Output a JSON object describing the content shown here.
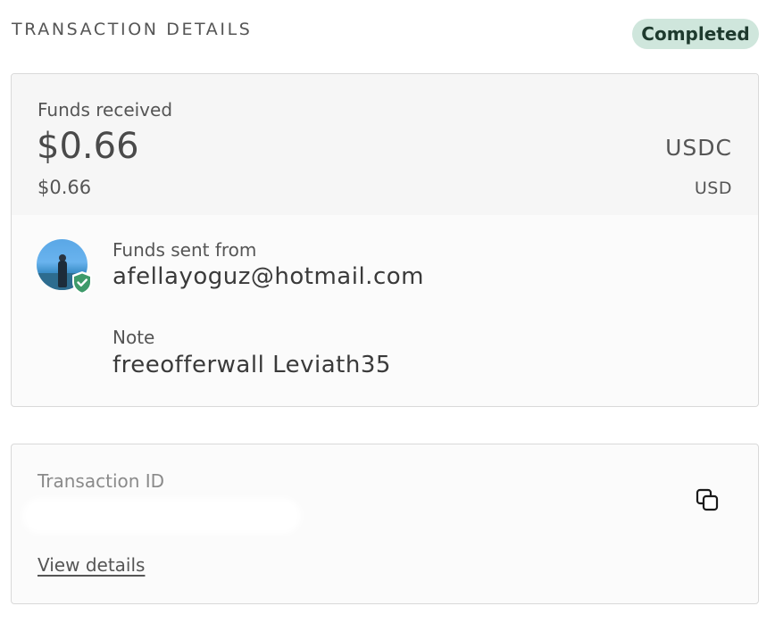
{
  "header": {
    "title": "TRANSACTION DETAILS",
    "status": "Completed",
    "status_color": "#cfe6dc"
  },
  "funds": {
    "label": "Funds received",
    "amount": "$0.66",
    "currency": "USDC",
    "fiat_amount": "$0.66",
    "fiat_currency": "USD"
  },
  "sender": {
    "label": "Funds sent from",
    "value": "afellayoguz@hotmail.com",
    "avatar_badge_icon": "verified-shield-icon",
    "badge_color": "#3e9a6a"
  },
  "note": {
    "label": "Note",
    "value": "freeofferwall Leviath35"
  },
  "transaction": {
    "label": "Transaction ID",
    "copy_icon": "copy-icon",
    "link_label": "View details"
  }
}
